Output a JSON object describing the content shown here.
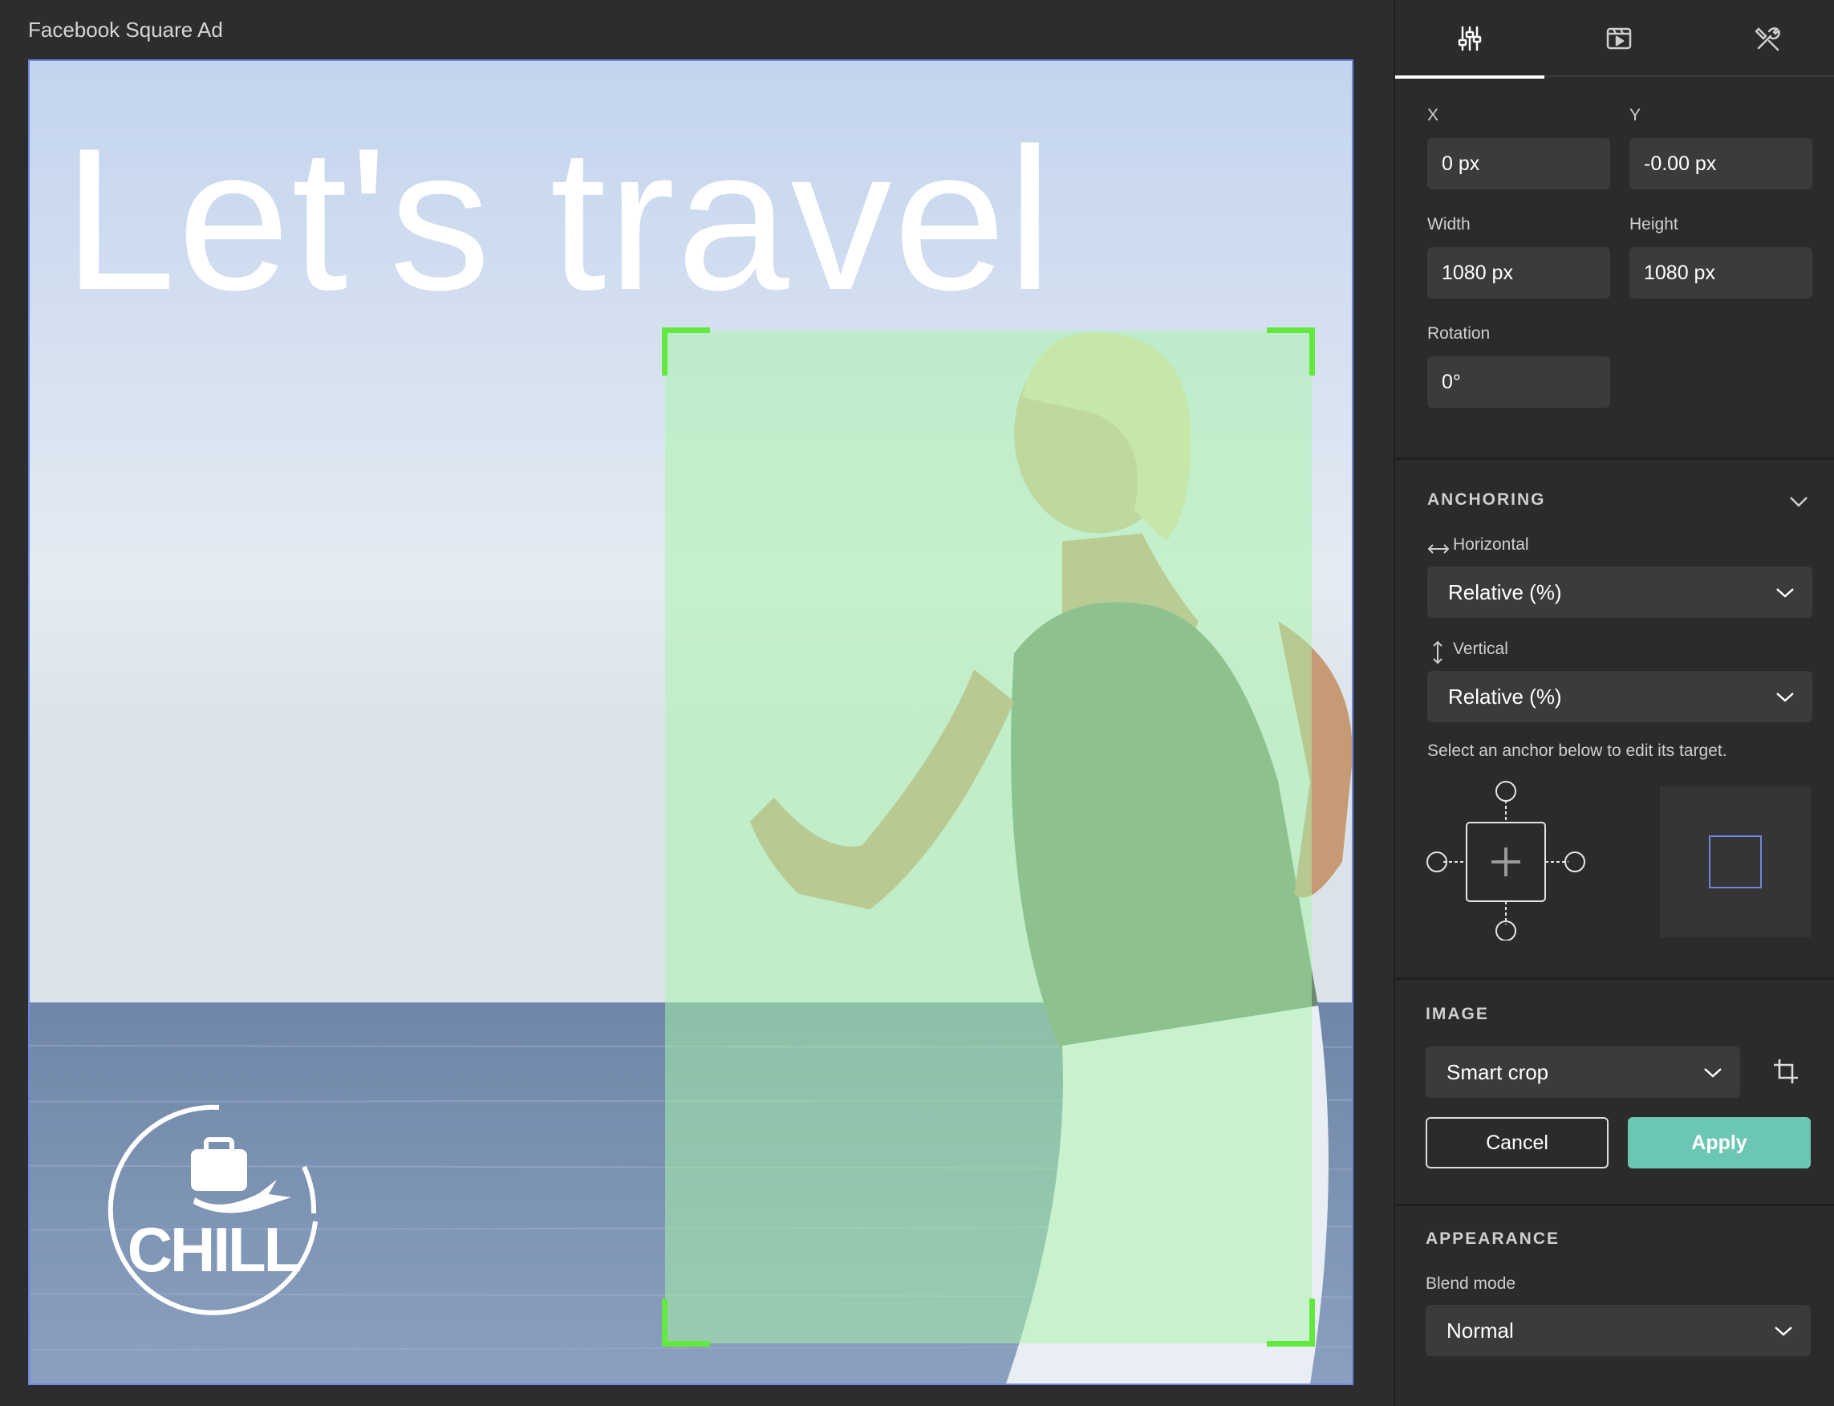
{
  "document": {
    "title": "Facebook Square Ad"
  },
  "canvas": {
    "headline": "Let's travel",
    "logo_text": "CHILL"
  },
  "panel": {
    "tabs": [
      {
        "icon": "sliders-icon",
        "active": true
      },
      {
        "icon": "media-player-icon",
        "active": false
      },
      {
        "icon": "tools-icon",
        "active": false
      }
    ],
    "position": {
      "x_label": "X",
      "x_value": "0 px",
      "y_label": "Y",
      "y_value": "-0.00 px",
      "width_label": "Width",
      "width_value": "1080 px",
      "height_label": "Height",
      "height_value": "1080 px",
      "rotation_label": "Rotation",
      "rotation_value": "0°"
    },
    "anchoring": {
      "title": "ANCHORING",
      "horizontal_label": "Horizontal",
      "horizontal_value": "Relative (%)",
      "vertical_label": "Vertical",
      "vertical_value": "Relative (%)",
      "help": "Select an anchor below to edit its target."
    },
    "image": {
      "title": "IMAGE",
      "crop_mode": "Smart crop",
      "cancel_label": "Cancel",
      "apply_label": "Apply"
    },
    "appearance": {
      "title": "APPEARANCE",
      "blend_label": "Blend mode",
      "blend_value": "Normal"
    }
  },
  "colors": {
    "accent_apply": "#6cc6b4",
    "crop_overlay": "#a8f5a8",
    "crop_handles": "#63e83f",
    "selection_border": "#6f86e0"
  }
}
